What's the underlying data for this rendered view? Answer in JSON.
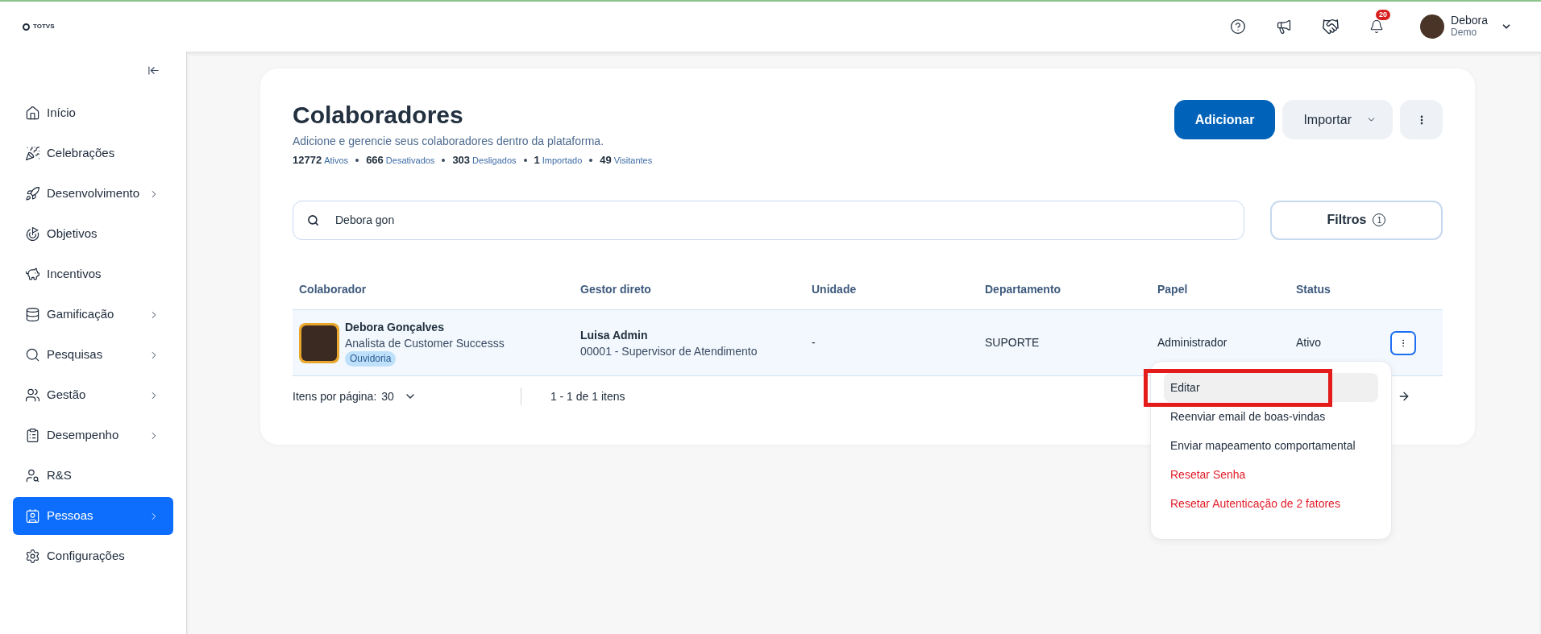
{
  "topbar": {
    "logo": "TOTVS",
    "notification_count": "20",
    "user_name": "Debora",
    "user_role": "Demo"
  },
  "sidebar": {
    "items": [
      {
        "label": "Início",
        "has_children": false,
        "selected": false
      },
      {
        "label": "Celebrações",
        "has_children": false,
        "selected": false
      },
      {
        "label": "Desenvolvimento",
        "has_children": true,
        "selected": false
      },
      {
        "label": "Objetivos",
        "has_children": false,
        "selected": false
      },
      {
        "label": "Incentivos",
        "has_children": false,
        "selected": false
      },
      {
        "label": "Gamificação",
        "has_children": true,
        "selected": false
      },
      {
        "label": "Pesquisas",
        "has_children": true,
        "selected": false
      },
      {
        "label": "Gestão",
        "has_children": true,
        "selected": false
      },
      {
        "label": "Desempenho",
        "has_children": true,
        "selected": false
      },
      {
        "label": "R&S",
        "has_children": false,
        "selected": false
      },
      {
        "label": "Pessoas",
        "has_children": true,
        "selected": true
      },
      {
        "label": "Configurações",
        "has_children": false,
        "selected": false
      }
    ]
  },
  "page": {
    "title": "Colaboradores",
    "subtitle": "Adicione e gerencie seus colaboradores dentro da plataforma.",
    "stats": [
      {
        "value": "12772",
        "label": "Ativos"
      },
      {
        "value": "666",
        "label": "Desativados"
      },
      {
        "value": "303",
        "label": "Desligados"
      },
      {
        "value": "1",
        "label": "Importado"
      },
      {
        "value": "49",
        "label": "Visitantes"
      }
    ],
    "add_button": "Adicionar",
    "import_button": "Importar",
    "search_value": "Debora gon",
    "filters_button": "Filtros",
    "filters_count": "1"
  },
  "table": {
    "columns": [
      "Colaborador",
      "Gestor direto",
      "Unidade",
      "Departamento",
      "Papel",
      "Status"
    ],
    "rows": [
      {
        "name": "Debora Gonçalves",
        "role": "Analista de Customer Successs",
        "tag": "Ouvidoria",
        "manager_name": "Luisa Admin",
        "manager_detail": "00001 - Supervisor de Atendimento",
        "unit": "-",
        "department": "SUPORTE",
        "papel": "Administrador",
        "status": "Ativo",
        "menu_open": true
      }
    ]
  },
  "pagination": {
    "label": "Itens por página:",
    "per_page": "30",
    "range": "1 - 1 de 1 itens"
  },
  "row_menu": {
    "items": [
      {
        "label": "Editar",
        "kind": "normal",
        "highlighted": true
      },
      {
        "label": "Reenviar email de boas-vindas",
        "kind": "normal",
        "highlighted": false
      },
      {
        "label": "Enviar mapeamento comportamental",
        "kind": "normal",
        "highlighted": false
      },
      {
        "label": "Resetar Senha",
        "kind": "danger",
        "highlighted": false
      },
      {
        "label": "Resetar Autenticação de 2 fatores",
        "kind": "danger",
        "highlighted": false
      }
    ]
  }
}
